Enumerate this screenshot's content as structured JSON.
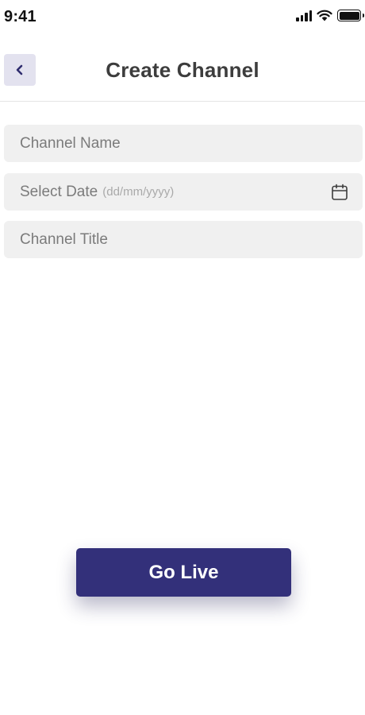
{
  "status_bar": {
    "time": "9:41",
    "icons": [
      "cellular-signal-icon",
      "wifi-icon",
      "battery-icon"
    ]
  },
  "header": {
    "title": "Create Channel",
    "back_icon": "chevron-left-icon"
  },
  "form": {
    "channel_name": {
      "placeholder": "Channel Name"
    },
    "date": {
      "placeholder": "Select Date",
      "hint": "(dd/mm/yyyy)",
      "icon": "calendar-icon"
    },
    "channel_title": {
      "placeholder": "Channel Title"
    }
  },
  "actions": {
    "go_live_label": "Go Live"
  },
  "colors": {
    "primary": "#33307a",
    "back_button_bg": "#e3e2ef",
    "field_bg": "#f0f0f0",
    "placeholder_text": "#7b7b7b"
  }
}
